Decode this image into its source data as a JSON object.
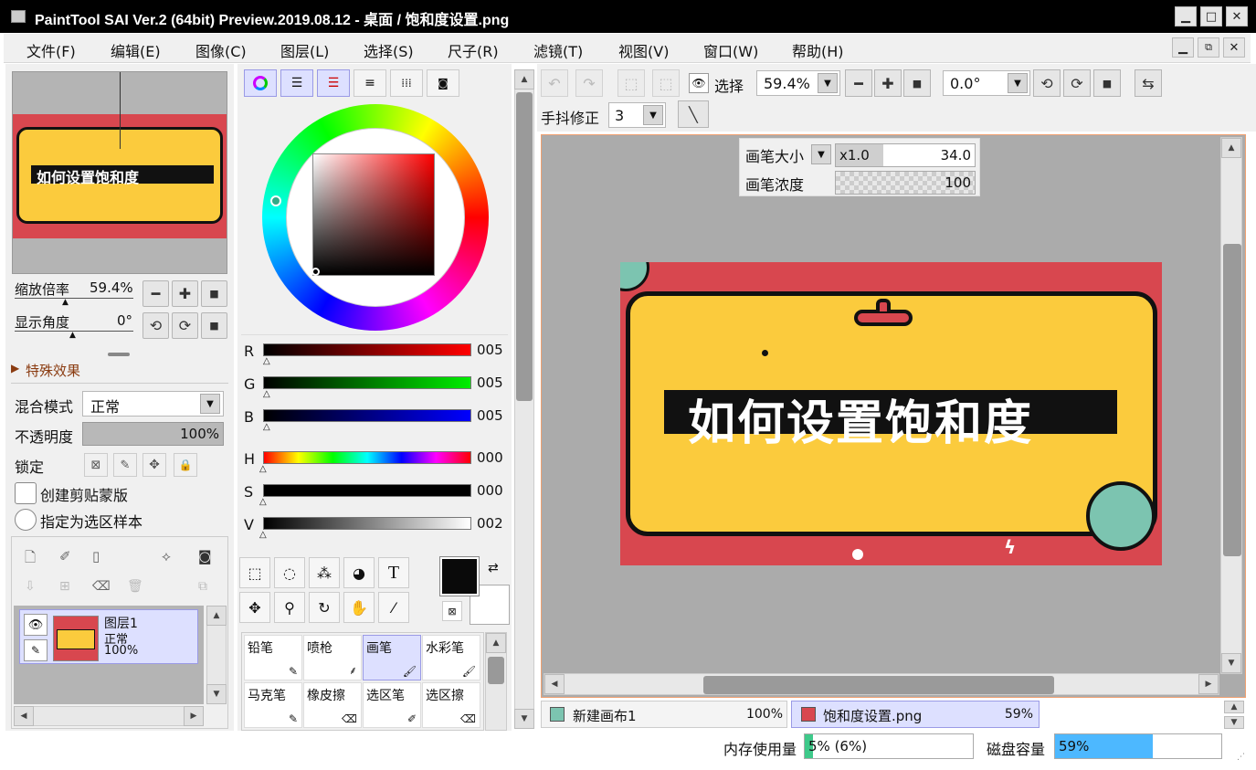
{
  "window": {
    "title": "PaintTool SAI Ver.2 (64bit) Preview.2019.08.12 - 桌面 / 饱和度设置.png",
    "minimize": "▁",
    "maximize": "□",
    "close": "✕"
  },
  "menu": [
    "文件(F)",
    "编辑(E)",
    "图像(C)",
    "图层(L)",
    "选择(S)",
    "尺子(R)",
    "滤镜(T)",
    "视图(V)",
    "窗口(W)",
    "帮助(H)"
  ],
  "navigator": {
    "zoom_label": "缩放倍率",
    "zoom_value": "59.4%",
    "angle_label": "显示角度",
    "angle_value": "0°"
  },
  "effects": {
    "label": "特殊效果"
  },
  "layer_props": {
    "blend_label": "混合模式",
    "blend_value": "正常",
    "opacity_label": "不透明度",
    "opacity_value": "100%",
    "opacity_fraction": 1.0,
    "lock_label": "锁定",
    "clip_label": "创建剪贴蒙版",
    "sample_label": "指定为选区样本"
  },
  "layer": {
    "name": "图层1",
    "mode": "正常",
    "opacity": "100%"
  },
  "color": {
    "sliders": [
      {
        "label": "R",
        "value": "005",
        "color": "#ff0000"
      },
      {
        "label": "G",
        "value": "005",
        "color": "#00e600"
      },
      {
        "label": "B",
        "value": "005",
        "color": "#0000ff"
      },
      {
        "label": "H",
        "value": "000",
        "color": "rainbow"
      },
      {
        "label": "S",
        "value": "000",
        "color": "#000000"
      },
      {
        "label": "V",
        "value": "002",
        "color": "#ffffff"
      }
    ],
    "foreground": "#0a0a0a",
    "background": "#ffffff"
  },
  "tools": [
    "selection-rect-icon",
    "lasso-icon",
    "magic-wand-icon",
    "shape-select-icon",
    "text-tool-icon",
    "move-icon",
    "zoom-icon",
    "rotate-icon",
    "hand-icon",
    "eyedropper-icon"
  ],
  "text_tool_glyph": "T",
  "brushes": [
    {
      "label": "铅笔",
      "selected": false
    },
    {
      "label": "喷枪",
      "selected": false
    },
    {
      "label": "画笔",
      "selected": true
    },
    {
      "label": "水彩笔",
      "selected": false
    },
    {
      "label": "马克笔",
      "selected": false
    },
    {
      "label": "橡皮擦",
      "selected": false
    },
    {
      "label": "选区笔",
      "selected": false
    },
    {
      "label": "选区擦",
      "selected": false
    }
  ],
  "toolbar": {
    "select_label": "选择",
    "zoom_value": "59.4%",
    "angle_value": "0.0°",
    "stabilizer_label": "手抖修正",
    "stabilizer_value": "3"
  },
  "brush_settings": {
    "size_label": "画笔大小",
    "size_multiplier": "x1.0",
    "size_value": "34.0",
    "density_label": "画笔浓度",
    "density_value": "100"
  },
  "canvas": {
    "banner_text": "如何设置饱和度"
  },
  "canvas_tabs": [
    {
      "name": "新建画布1",
      "zoom": "100%"
    },
    {
      "name": "饱和度设置.png",
      "zoom": "59%"
    }
  ],
  "status": {
    "memory_label": "内存使用量",
    "memory_value": "5% (6%)",
    "memory_fraction": 0.05,
    "disk_label": "磁盘容量",
    "disk_value": "59%",
    "disk_fraction": 0.59
  }
}
